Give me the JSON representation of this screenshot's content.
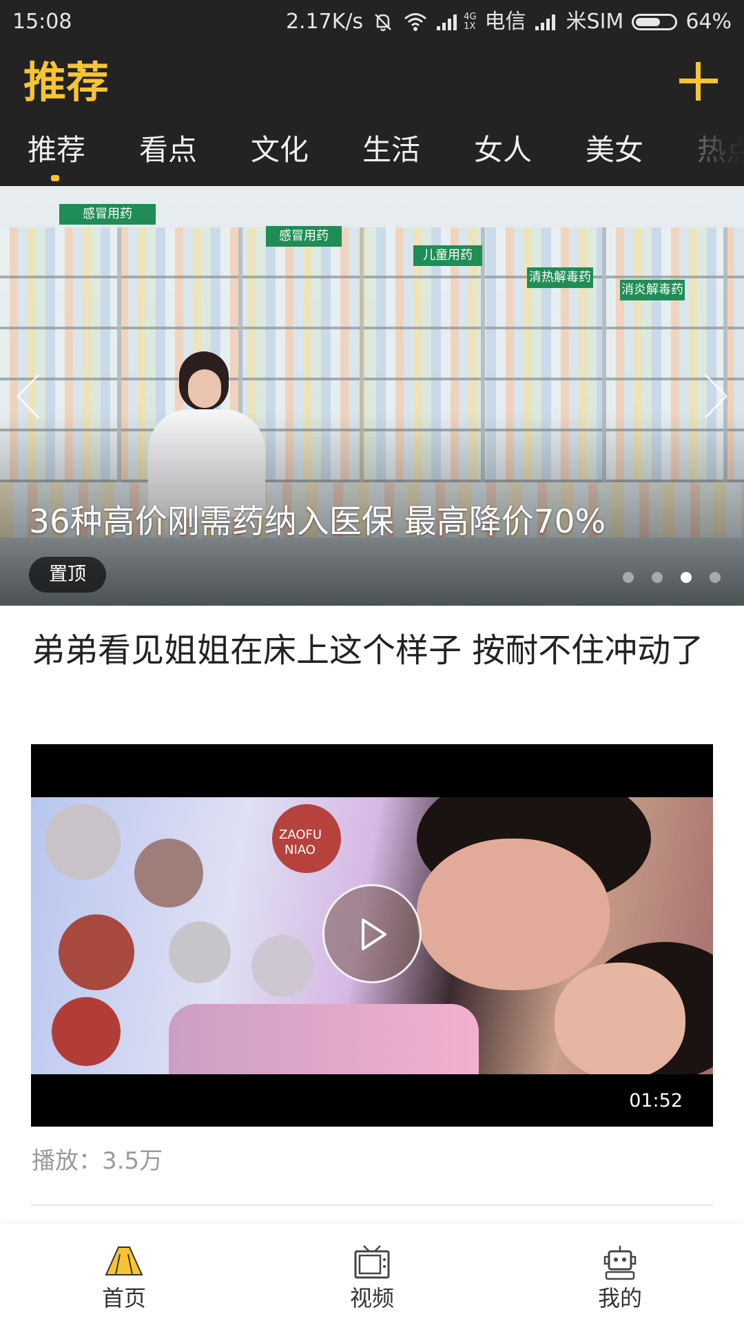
{
  "status_bar": {
    "time": "15:08",
    "net_speed": "2.17K/s",
    "net_type_top": "4G",
    "net_type_bottom": "1X",
    "carrier1": "电信",
    "carrier2": "米SIM",
    "battery_percent": "64%",
    "battery_level": 0.64,
    "icons": [
      "mute-bell-icon",
      "wifi-icon",
      "signal-icon",
      "battery-icon"
    ]
  },
  "header": {
    "title": "推荐",
    "add_icon": "plus-icon",
    "accent_color": "#f7c531",
    "background_color": "#232323"
  },
  "tabs": [
    {
      "label": "推荐",
      "active": true
    },
    {
      "label": "看点"
    },
    {
      "label": "文化"
    },
    {
      "label": "生活"
    },
    {
      "label": "女人"
    },
    {
      "label": "美女"
    },
    {
      "label": "热点"
    }
  ],
  "banner": {
    "title": "36种高价刚需药纳入医保 最高降价70%",
    "badge": "置顶",
    "slide_count": 4,
    "active_slide": 3,
    "signs": [
      "感冒用药",
      "感冒用药",
      "儿童用药",
      "清热解毒药",
      "消炎解毒药"
    ]
  },
  "article": {
    "title": "弟弟看见姐姐在床上这个样子 按耐不住冲动了",
    "video_duration": "01:52",
    "play_count": "播放：3.5万",
    "pillow_print": [
      "ZAOFU",
      "NIAO"
    ]
  },
  "bottom_nav": [
    {
      "label": "首页",
      "icon": "home-icon",
      "active": true
    },
    {
      "label": "视频",
      "icon": "tv-icon"
    },
    {
      "label": "我的",
      "icon": "robot-profile-icon"
    }
  ]
}
